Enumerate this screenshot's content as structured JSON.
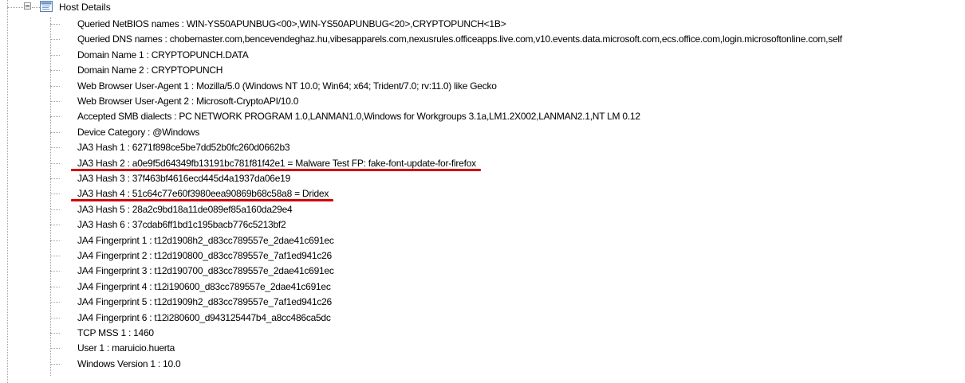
{
  "root": {
    "label": "Host Details"
  },
  "items": [
    {
      "label": "Queried NetBIOS names : WIN-YS50APUNBUG<00>,WIN-YS50APUNBUG<20>,CRYPTOPUNCH<1B>"
    },
    {
      "label": "Queried DNS names : chobemaster.com,bencevendeghaz.hu,vibesapparels.com,nexusrules.officeapps.live.com,v10.events.data.microsoft.com,ecs.office.com,login.microsoftonline.com,self"
    },
    {
      "label": "Domain Name 1 : CRYPTOPUNCH.DATA"
    },
    {
      "label": "Domain Name 2 : CRYPTOPUNCH"
    },
    {
      "label": "Web Browser User-Agent 1 : Mozilla/5.0 (Windows NT 10.0; Win64; x64; Trident/7.0; rv:11.0) like Gecko"
    },
    {
      "label": "Web Browser User-Agent 2 : Microsoft-CryptoAPI/10.0"
    },
    {
      "label": "Accepted SMB dialects : PC NETWORK PROGRAM 1.0,LANMAN1.0,Windows for Workgroups 3.1a,LM1.2X002,LANMAN2.1,NT LM 0.12"
    },
    {
      "label": "Device Category : @Windows"
    },
    {
      "label": "JA3 Hash 1 : 6271f898ce5be7dd52b0fc260d0662b3"
    },
    {
      "label": "JA3 Hash 2 : a0e9f5d64349fb13191bc781f81f42e1 = Malware Test FP: fake-font-update-for-firefox",
      "highlighted": true
    },
    {
      "label": "JA3 Hash 3 : 37f463bf4616ecd445d4a1937da06e19"
    },
    {
      "label": "JA3 Hash 4 : 51c64c77e60f3980eea90869b68c58a8 = Dridex",
      "highlighted": true
    },
    {
      "label": "JA3 Hash 5 : 28a2c9bd18a11de089ef85a160da29e4"
    },
    {
      "label": "JA3 Hash 6 : 37cdab6ff1bd1c195bacb776c5213bf2"
    },
    {
      "label": "JA4 Fingerprint 1 : t12d1908h2_d83cc789557e_2dae41c691ec"
    },
    {
      "label": "JA4 Fingerprint 2 : t12d190800_d83cc789557e_7af1ed941c26"
    },
    {
      "label": "JA4 Fingerprint 3 : t12d190700_d83cc789557e_2dae41c691ec"
    },
    {
      "label": "JA4 Fingerprint 4 : t12i190600_d83cc789557e_2dae41c691ec"
    },
    {
      "label": "JA4 Fingerprint 5 : t12d1909h2_d83cc789557e_7af1ed941c26"
    },
    {
      "label": "JA4 Fingerprint 6 : t12i280600_d943125447b4_a8cc486ca5dc"
    },
    {
      "label": "TCP MSS 1 : 1460"
    },
    {
      "label": "User 1 : maruicio.huerta"
    },
    {
      "label": "Windows Version 1 : 10.0"
    }
  ],
  "colors": {
    "highlight_underline": "#d40000",
    "tree_lines": "#a0a0a0"
  },
  "icons": {
    "expander": "collapse-minus-icon",
    "root_node": "host-details-icon"
  }
}
